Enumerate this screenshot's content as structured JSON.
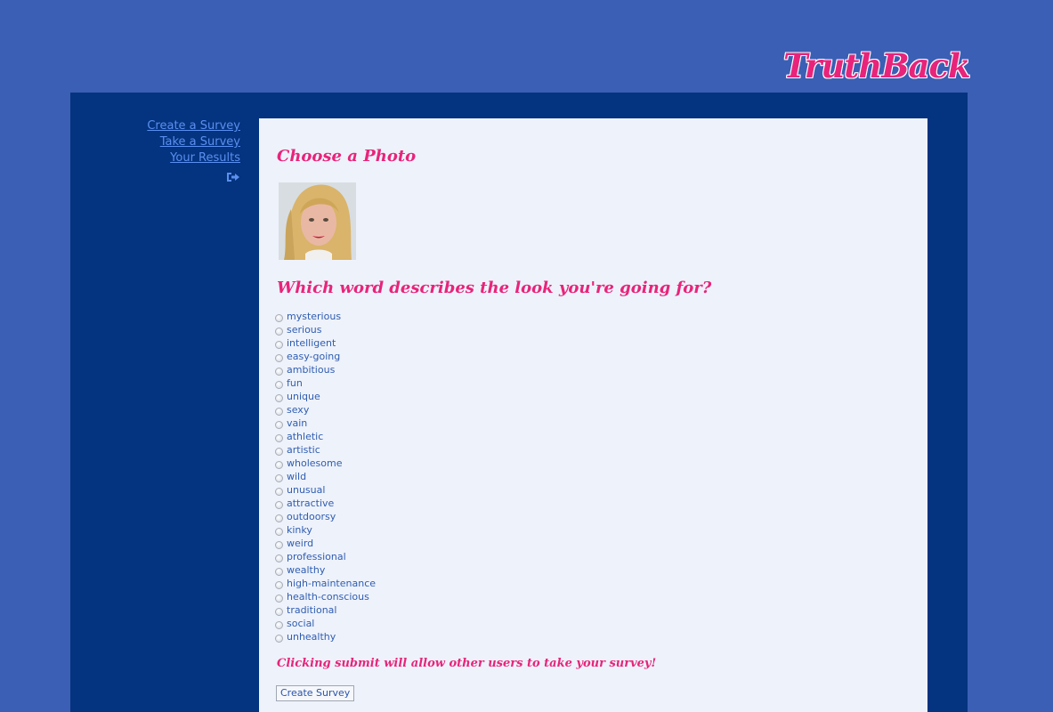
{
  "brand": {
    "logo_text": "TruthBack",
    "accent_color": "#e8247a"
  },
  "nav": {
    "items": [
      {
        "label": "Create a Survey"
      },
      {
        "label": "Take a Survey"
      },
      {
        "label": "Your Results"
      }
    ],
    "logout_icon": "sign-out-icon"
  },
  "main": {
    "photo_heading": "Choose a Photo",
    "question_heading": "Which word describes the look you're going for?",
    "options": [
      "mysterious",
      "serious",
      "intelligent",
      "easy-going",
      "ambitious",
      "fun",
      "unique",
      "sexy",
      "vain",
      "athletic",
      "artistic",
      "wholesome",
      "wild",
      "unusual",
      "attractive",
      "outdoorsy",
      "kinky",
      "weird",
      "professional",
      "wealthy",
      "high-maintenance",
      "health-conscious",
      "traditional",
      "social",
      "unhealthy"
    ],
    "notice": "Clicking submit will allow other users to take your survey!",
    "submit_label": "Create Survey"
  }
}
